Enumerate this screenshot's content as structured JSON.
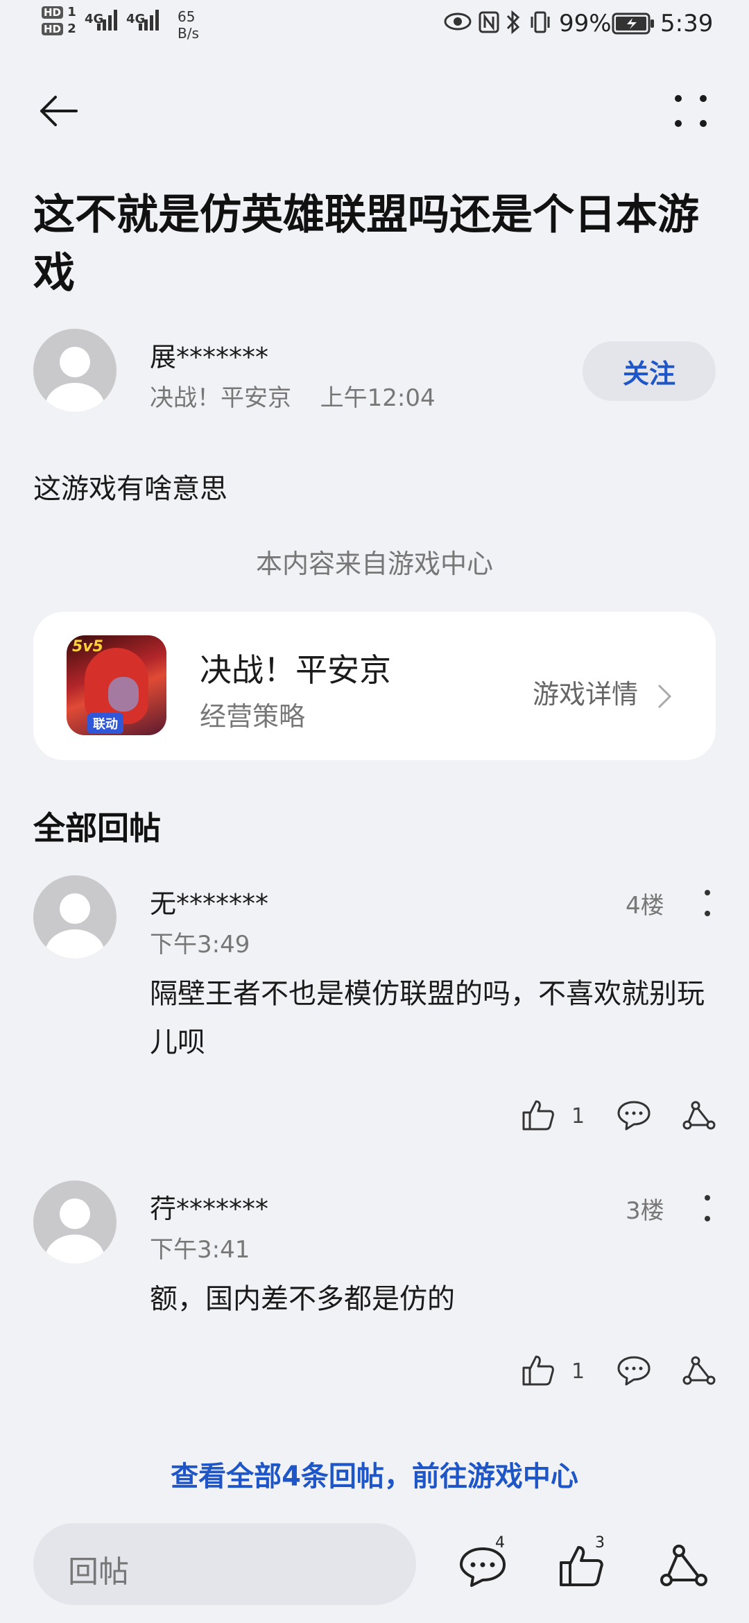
{
  "status_bar": {
    "hd1": "HD",
    "hd1_num": "1",
    "hd2": "HD",
    "hd2_num": "2",
    "net1": "4G",
    "net2": "4G",
    "speed_value": "65",
    "speed_unit": "B/s",
    "battery": "99%",
    "time": "5:39"
  },
  "post": {
    "title": "这不就是仿英雄联盟吗还是个日本游戏",
    "author": "展*******",
    "game": "决战！平安京",
    "time": "上午12:04",
    "follow_label": "关注",
    "body": "这游戏有啥意思",
    "source_note": "本内容来自游戏中心"
  },
  "game_card": {
    "name": "决战！平安京",
    "genre": "经营策略",
    "detail_label": "游戏详情",
    "icon_logo": "5v5",
    "icon_badge": "联动"
  },
  "replies_section": {
    "title": "全部回帖",
    "items": [
      {
        "name": "无*******",
        "time": "下午3:49",
        "floor": "4楼",
        "text": "隔壁王者不也是模仿联盟的吗，不喜欢就别玩儿呗",
        "likes": "1"
      },
      {
        "name": "荇*******",
        "time": "下午3:41",
        "floor": "3楼",
        "text": "额，国内差不多都是仿的",
        "likes": "1"
      }
    ]
  },
  "view_all_label": "查看全部4条回帖，前往游戏中心",
  "bottom_bar": {
    "reply_placeholder": "回帖",
    "comment_count": "4",
    "like_count": "3"
  },
  "colors": {
    "accent": "#1f56c7",
    "background": "#f1f2f5"
  }
}
